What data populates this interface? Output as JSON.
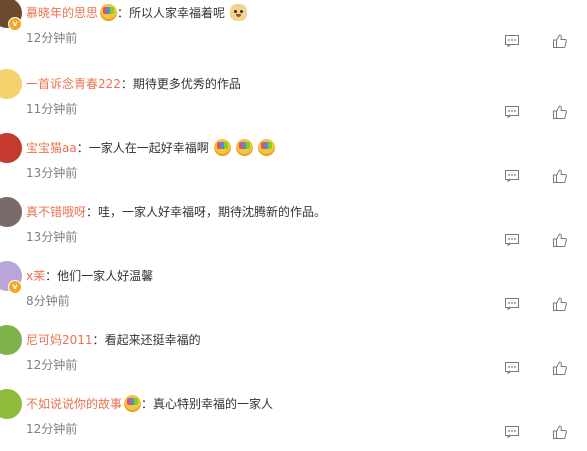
{
  "comments": [
    {
      "username": "慕晓年的思思",
      "verified": true,
      "before_emojis": [
        "cheer"
      ],
      "text": "所以人家幸福着呢",
      "emojis": [
        "dog"
      ],
      "time": "12分钟前",
      "avatar_color": "#6b4a2e",
      "reply_icon": "comment-icon",
      "like_icon": "thumb-up-icon"
    },
    {
      "username": "一首诉念青春222",
      "verified": false,
      "before_emojis": [],
      "text": "期待更多优秀的作品",
      "emojis": [],
      "time": "11分钟前",
      "avatar_color": "#f4d26b",
      "reply_icon": "comment-icon",
      "like_icon": "thumb-up-icon"
    },
    {
      "username": "宝宝猫aa",
      "verified": false,
      "before_emojis": [],
      "text": "一家人在一起好幸福啊",
      "emojis": [
        "cheer",
        "cheer",
        "cheer"
      ],
      "time": "13分钟前",
      "avatar_color": "#c43a2e",
      "reply_icon": "comment-icon",
      "like_icon": "thumb-up-icon"
    },
    {
      "username": "真不错哦呀",
      "verified": false,
      "before_emojis": [],
      "text": "哇，一家人好幸福呀，期待沈腾新的作品。",
      "emojis": [],
      "time": "13分钟前",
      "avatar_color": "#7a6a6a",
      "reply_icon": "comment-icon",
      "like_icon": "thumb-up-icon"
    },
    {
      "username": "x茉",
      "verified": true,
      "before_emojis": [],
      "text": "他们一家人好温馨",
      "emojis": [],
      "time": "8分钟前",
      "avatar_color": "#b8a6d9",
      "reply_icon": "comment-icon",
      "like_icon": "thumb-up-icon"
    },
    {
      "username": "尼可妈2011",
      "verified": false,
      "before_emojis": [],
      "text": "看起来还挺幸福的",
      "emojis": [],
      "time": "12分钟前",
      "avatar_color": "#7fb24a",
      "reply_icon": "comment-icon",
      "like_icon": "thumb-up-icon"
    },
    {
      "username": "不如说说你的故事",
      "verified": false,
      "before_emojis": [
        "cheer"
      ],
      "text": "真心特别幸福的一家人",
      "emojis": [],
      "time": "12分钟前",
      "avatar_color": "#8dbb3c",
      "reply_icon": "comment-icon",
      "like_icon": "thumb-up-icon"
    }
  ]
}
